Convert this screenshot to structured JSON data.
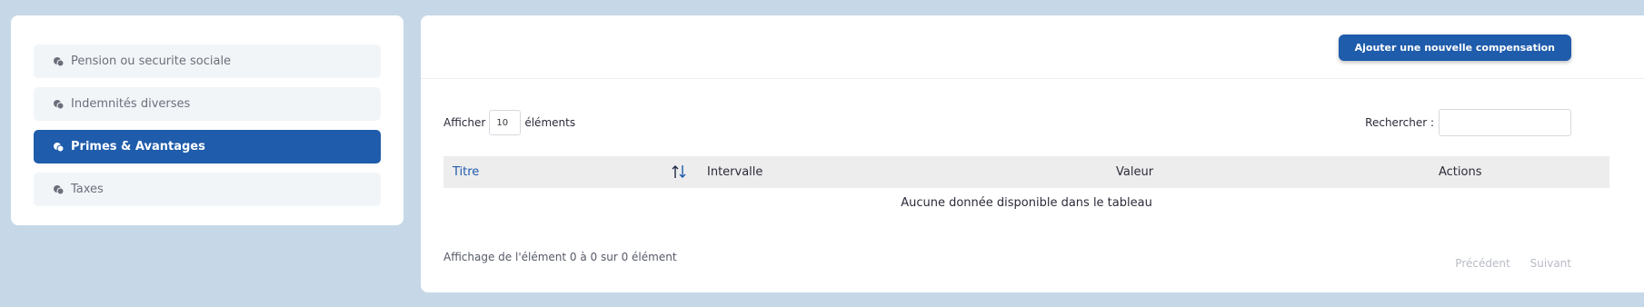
{
  "sidebar": {
    "items": [
      {
        "label": "Pension ou securite sociale"
      },
      {
        "label": "Indemnités diverses"
      },
      {
        "label": "Primes & Avantages"
      },
      {
        "label": "Taxes"
      }
    ],
    "active_index": 2
  },
  "main": {
    "add_button_label": "Ajouter une nouvelle compensation",
    "show_prefix": "Afficher",
    "show_value": "10",
    "show_suffix": "éléments",
    "search_label": "Rechercher :",
    "search_value": "",
    "columns": [
      "Titre",
      "Intervalle",
      "Valeur",
      "Actions"
    ],
    "empty_message": "Aucune donnée disponible dans le tableau",
    "info_text": "Affichage de l'élément 0 à 0 sur 0 élément",
    "pager": {
      "previous": "Précédent",
      "next": "Suivant"
    }
  },
  "colors": {
    "background": "#c6d8e8",
    "accent": "#1f5cab",
    "table_header_bg": "#ededed"
  },
  "icons": {
    "sidebar_item": "chat-bubbles-icon",
    "sort": "sort-arrows-icon"
  }
}
